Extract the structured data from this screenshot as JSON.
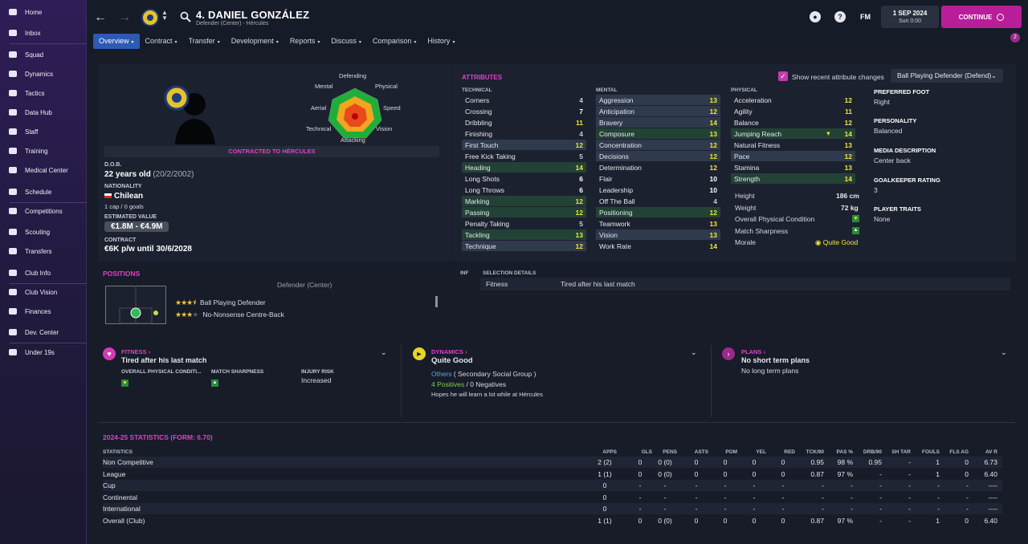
{
  "sidebar": {
    "items": [
      {
        "label": "Home",
        "icon": "home-icon"
      },
      {
        "label": "Inbox",
        "icon": "inbox-icon"
      },
      {
        "label": "Squad",
        "icon": "squad-icon"
      },
      {
        "label": "Dynamics",
        "icon": "dynamics-icon"
      },
      {
        "label": "Tactics",
        "icon": "tactics-icon"
      },
      {
        "label": "Data Hub",
        "icon": "data-hub-icon"
      },
      {
        "label": "Staff",
        "icon": "staff-icon"
      },
      {
        "label": "Training",
        "icon": "training-icon"
      },
      {
        "label": "Medical Center",
        "icon": "medical-icon"
      },
      {
        "label": "Schedule",
        "icon": "schedule-icon"
      },
      {
        "label": "Competitions",
        "icon": "trophy-icon"
      },
      {
        "label": "Scouting",
        "icon": "scouting-icon"
      },
      {
        "label": "Transfers",
        "icon": "transfers-icon"
      },
      {
        "label": "Club Info",
        "icon": "club-info-icon"
      },
      {
        "label": "Club Vision",
        "icon": "club-vision-icon"
      },
      {
        "label": "Finances",
        "icon": "finances-icon"
      },
      {
        "label": "Dev. Center",
        "icon": "dev-center-icon"
      },
      {
        "label": "Under 19s",
        "icon": "under19-icon"
      }
    ]
  },
  "header": {
    "player_name": "4. DANIEL GONZÁLEZ",
    "subtitle": "Defender (Center) - Hércules",
    "fm": "FM",
    "date": "1 SEP 2024",
    "time": "Sun 0:00",
    "continue": "CONTINUE",
    "badge": "2"
  },
  "tabs": [
    "Overview",
    "Contract",
    "Transfer",
    "Development",
    "Reports",
    "Discuss",
    "Comparison",
    "History"
  ],
  "profile": {
    "radar_labels": {
      "top": "Defending",
      "tl": "Mental",
      "tr": "Physical",
      "l": "Aerial",
      "r": "Speed",
      "bl": "Technical",
      "br": "Vision",
      "bottom": "Attacking"
    },
    "contracted": "CONTRACTED TO HÉRCULES",
    "dob_label": "D.O.B.",
    "dob_age": "22 years old",
    "dob_date": "(20/2/2002)",
    "nat_label": "NATIONALITY",
    "nationality": "Chilean",
    "caps": "1 cap / 0 goals",
    "value_label": "ESTIMATED VALUE",
    "value": "€1.8M - €4.9M",
    "contract_label": "CONTRACT",
    "contract": "€6K p/w until 30/6/2028"
  },
  "attributes": {
    "title": "ATTRIBUTES",
    "show_changes": "Show recent attribute changes",
    "role": "Ball Playing Defender (Defend)",
    "technical_head": "TECHNICAL",
    "mental_head": "MENTAL",
    "physical_head": "PHYSICAL",
    "technical": [
      [
        "Corners",
        "4",
        "g",
        ""
      ],
      [
        "Crossing",
        "7",
        "w",
        ""
      ],
      [
        "Dribbling",
        "11",
        "y",
        ""
      ],
      [
        "Finishing",
        "4",
        "g",
        ""
      ],
      [
        "First Touch",
        "12",
        "y",
        "hl"
      ],
      [
        "Free Kick Taking",
        "5",
        "g",
        ""
      ],
      [
        "Heading",
        "14",
        "y",
        "hlg"
      ],
      [
        "Long Shots",
        "6",
        "w",
        ""
      ],
      [
        "Long Throws",
        "6",
        "w",
        ""
      ],
      [
        "Marking",
        "12",
        "y",
        "hlg"
      ],
      [
        "Passing",
        "12",
        "y",
        "hlg"
      ],
      [
        "Penalty Taking",
        "5",
        "g",
        ""
      ],
      [
        "Tackling",
        "13",
        "y",
        "hlg"
      ],
      [
        "Technique",
        "12",
        "y",
        "hl"
      ]
    ],
    "mental": [
      [
        "Aggression",
        "13",
        "y",
        "hl"
      ],
      [
        "Anticipation",
        "12",
        "y",
        "hl"
      ],
      [
        "Bravery",
        "14",
        "y",
        "hl"
      ],
      [
        "Composure",
        "13",
        "y",
        "hlg"
      ],
      [
        "Concentration",
        "12",
        "y",
        "hl"
      ],
      [
        "Decisions",
        "12",
        "y",
        "hl"
      ],
      [
        "Determination",
        "12",
        "y",
        ""
      ],
      [
        "Flair",
        "10",
        "w",
        ""
      ],
      [
        "Leadership",
        "10",
        "w",
        ""
      ],
      [
        "Off The Ball",
        "4",
        "g",
        ""
      ],
      [
        "Positioning",
        "12",
        "y",
        "hlg"
      ],
      [
        "Teamwork",
        "13",
        "y",
        ""
      ],
      [
        "Vision",
        "13",
        "y",
        "hl"
      ],
      [
        "Work Rate",
        "14",
        "y",
        ""
      ]
    ],
    "physical": [
      [
        "Acceleration",
        "12",
        "y",
        ""
      ],
      [
        "Agility",
        "11",
        "y",
        ""
      ],
      [
        "Balance",
        "12",
        "y",
        ""
      ],
      [
        "Jumping Reach",
        "14",
        "y",
        "hlg"
      ],
      [
        "Natural Fitness",
        "13",
        "y",
        ""
      ],
      [
        "Pace",
        "12",
        "y",
        "hl"
      ],
      [
        "Stamina",
        "13",
        "y",
        ""
      ],
      [
        "Strength",
        "14",
        "y",
        "hlg"
      ]
    ],
    "height_label": "Height",
    "height": "186 cm",
    "weight_label": "Weight",
    "weight": "72 kg",
    "opc_label": "Overall Physical Condition",
    "sharp_label": "Match Sharpness",
    "morale_label": "Morale",
    "morale": "Quite Good"
  },
  "info": {
    "foot_label": "PREFERRED FOOT",
    "foot": "Right",
    "pers_label": "PERSONALITY",
    "personality": "Balanced",
    "media_label": "MEDIA DESCRIPTION",
    "media": "Center back",
    "gk_label": "GOALKEEPER RATING",
    "gk": "3",
    "traits_label": "PLAYER TRAITS",
    "traits": "None"
  },
  "positions": {
    "title": "POSITIONS",
    "main": "Defender (Center)",
    "roles": [
      {
        "name": "Ball Playing Defender",
        "stars": 3.5
      },
      {
        "name": "No-Nonsense Centre-Back",
        "stars": 3
      }
    ]
  },
  "selection": {
    "inf": "INF",
    "head": "SELECTION DETAILS",
    "item": "Fitness",
    "desc": "Tired after his last match"
  },
  "fitness": {
    "title": "FITNESS",
    "status": "Tired after his last match",
    "opc": "OVERALL PHYSICAL CONDITI...",
    "sharp": "MATCH SHARPNESS",
    "inj_label": "INJURY RISK",
    "inj": "Increased"
  },
  "dynamics": {
    "title": "DYNAMICS",
    "status": "Quite Good",
    "group": "Others",
    "group_sub": "( Secondary Social Group )",
    "pos": "4 Positives",
    "neg": "0 Negatives",
    "hope": "Hopes he will learn a lot while at Hércules"
  },
  "plans": {
    "title": "PLANS",
    "status": "No short term plans",
    "sub": "No long term plans"
  },
  "stats": {
    "title": "2024-25 STATISTICS (FORM: 6.70)",
    "cols": [
      "STATISTICS",
      "APPS",
      "GLS",
      "PENS",
      "ASTS",
      "POM",
      "YEL",
      "RED",
      "TCK/90",
      "PAS %",
      "DRB/90",
      "SH TAR",
      "FOULS",
      "FLS AG",
      "AV R"
    ],
    "rows": [
      [
        "Non Competitive",
        "2 (2)",
        "0",
        "0 (0)",
        "0",
        "0",
        "0",
        "0",
        "0.95",
        "98 %",
        "0.95",
        "-",
        "1",
        "0",
        "6.73"
      ],
      [
        "League",
        "1 (1)",
        "0",
        "0 (0)",
        "0",
        "0",
        "0",
        "0",
        "0.87",
        "97 %",
        "-",
        "-",
        "1",
        "0",
        "6.40"
      ],
      [
        "Cup",
        "0",
        "-",
        "-",
        "-",
        "-",
        "-",
        "-",
        "-",
        "-",
        "-",
        "-",
        "-",
        "-",
        "----"
      ],
      [
        "Continental",
        "0",
        "-",
        "-",
        "-",
        "-",
        "-",
        "-",
        "-",
        "-",
        "-",
        "-",
        "-",
        "-",
        "----"
      ],
      [
        "International",
        "0",
        "-",
        "-",
        "-",
        "-",
        "-",
        "-",
        "-",
        "-",
        "-",
        "-",
        "-",
        "-",
        "----"
      ],
      [
        "Overall (Club)",
        "1 (1)",
        "0",
        "0 (0)",
        "0",
        "0",
        "0",
        "0",
        "0.87",
        "97 %",
        "-",
        "-",
        "1",
        "0",
        "6.40"
      ]
    ]
  }
}
